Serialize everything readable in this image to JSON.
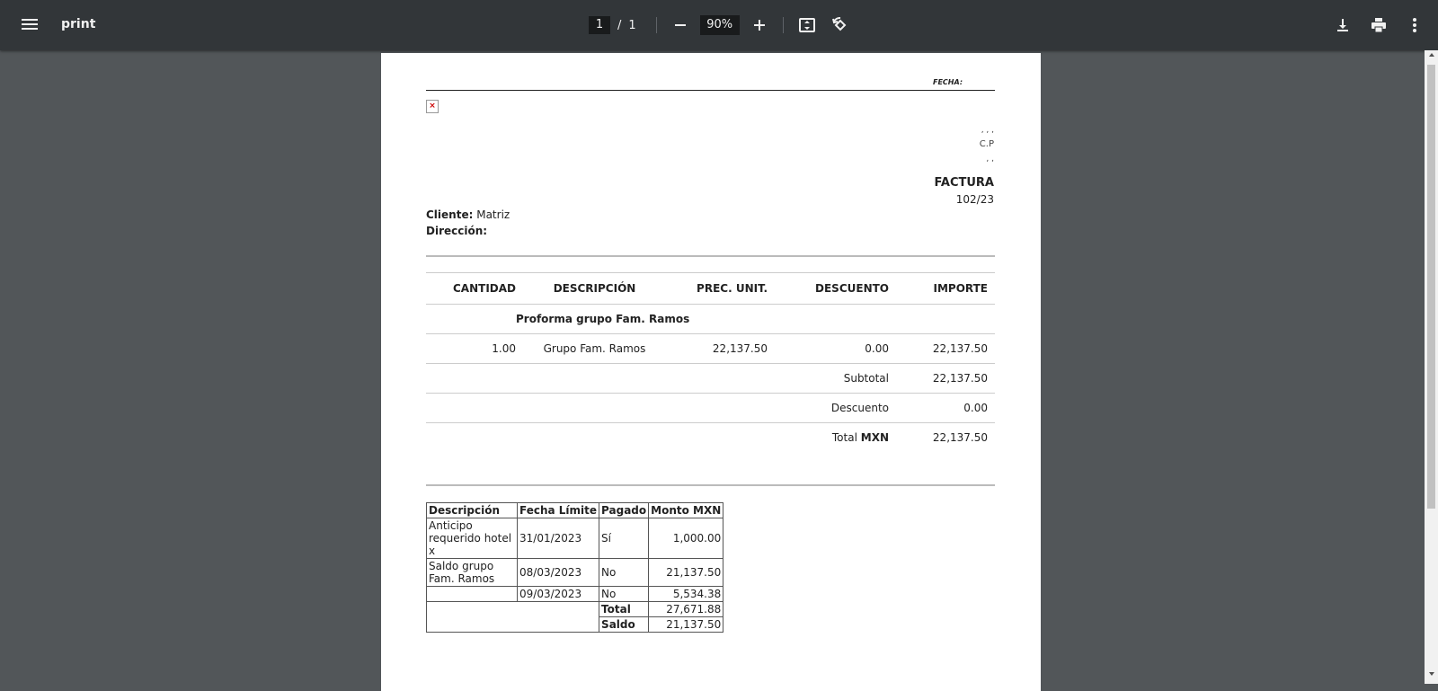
{
  "toolbar": {
    "title": "print",
    "page_current": "1",
    "page_separator": "/",
    "page_total": "1",
    "zoom": "90%"
  },
  "doc": {
    "fecha_label": "FECHA:",
    "addr_line1": ", , ,",
    "addr_line2": "C.P",
    "addr_line3": ", ,",
    "factura_label": "FACTURA",
    "factura_number": "102/23",
    "cliente_label": "Cliente:",
    "cliente_value": "Matriz",
    "direccion_label": "Dirección:",
    "items_headers": [
      "CANTIDAD",
      "DESCRIPCIÓN",
      "PREC. UNIT.",
      "DESCUENTO",
      "IMPORTE"
    ],
    "section_title": "Proforma grupo Fam. Ramos",
    "item": {
      "cantidad": "1.00",
      "descripcion": "Grupo Fam. Ramos",
      "prec_unit": "22,137.50",
      "descuento": "0.00",
      "importe": "22,137.50"
    },
    "subtotal_label": "Subtotal",
    "subtotal_value": "22,137.50",
    "descuento_label": "Descuento",
    "descuento_value": "0.00",
    "total_label": "Total",
    "total_currency": "MXN",
    "total_value": "22,137.50",
    "pay_headers": [
      "Descripción",
      "Fecha Límite",
      "Pagado",
      "Monto MXN"
    ],
    "pay_rows": [
      {
        "desc": "Anticipo requerido hotel x",
        "fecha": "31/01/2023",
        "pagado": "Sí",
        "monto": "1,000.00"
      },
      {
        "desc": "Saldo grupo Fam. Ramos",
        "fecha": "08/03/2023",
        "pagado": "No",
        "monto": "21,137.50"
      },
      {
        "desc": "",
        "fecha": "09/03/2023",
        "pagado": "No",
        "monto": "5,534.38"
      }
    ],
    "pay_total_label": "Total",
    "pay_total_value": "27,671.88",
    "pay_saldo_label": "Saldo",
    "pay_saldo_value": "21,137.50"
  }
}
